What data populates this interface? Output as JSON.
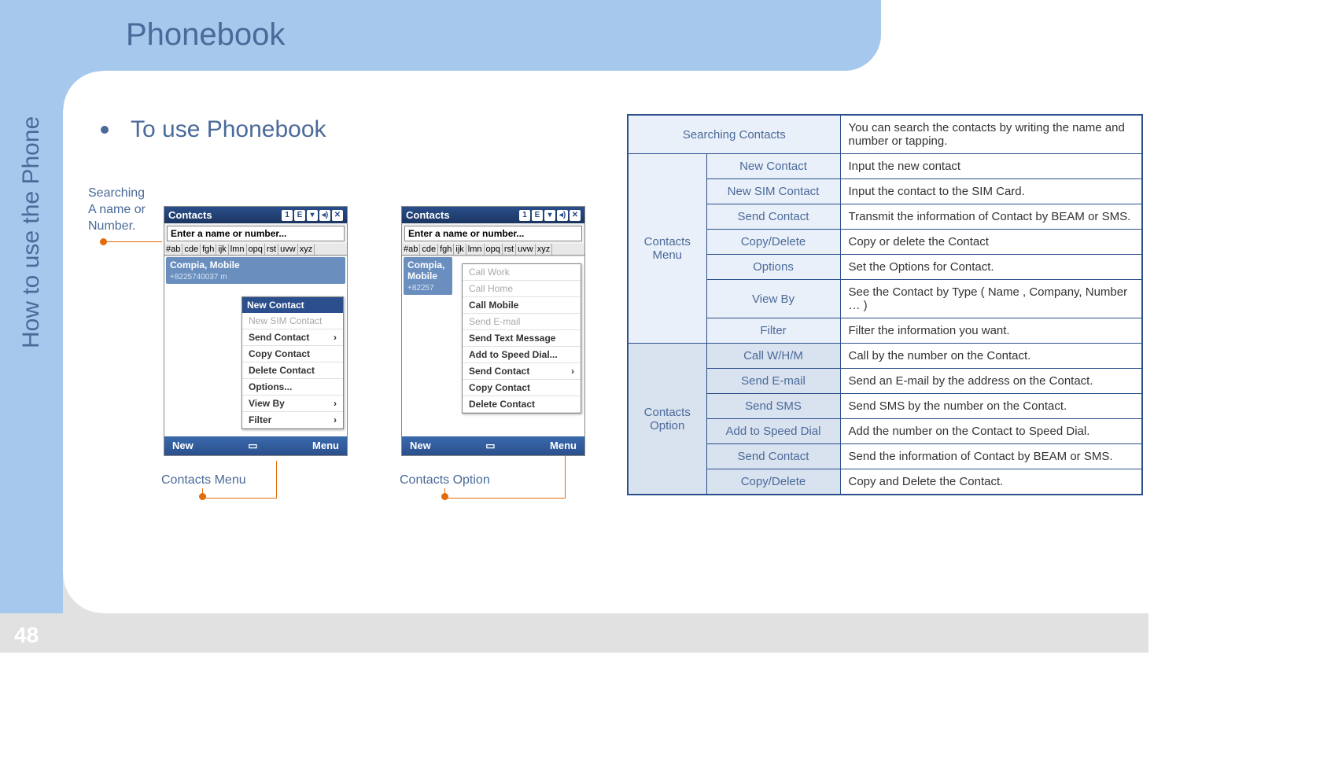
{
  "page": {
    "title": "Phonebook",
    "sidebar_text": "How to use the Phone",
    "page_number": "48",
    "section": "To use Phonebook"
  },
  "annotations": {
    "search_label": "Searching\nA name or\nNumber.",
    "contacts_menu_label": "Contacts Menu",
    "contacts_option_label": "Contacts Option"
  },
  "phone": {
    "title": "Contacts",
    "search_placeholder": "Enter a name or number...",
    "tabs": [
      "#ab",
      "cde",
      "fgh",
      "ijk",
      "lmn",
      "opq",
      "rst",
      "uvw",
      "xyz"
    ],
    "contact_name": "Compia, Mobile",
    "contact_num": "+8225740037 m",
    "contact_num2": "+82257",
    "soft_left": "New",
    "soft_right": "Menu",
    "menu1": {
      "header": "New Contact",
      "items": [
        {
          "t": "New SIM Contact",
          "dis": true
        },
        {
          "t": "Send Contact",
          "sub": true
        },
        {
          "t": "Copy Contact"
        },
        {
          "t": "Delete Contact"
        },
        {
          "t": "Options..."
        },
        {
          "t": "View By",
          "sub": true
        },
        {
          "t": "Filter",
          "sub": true
        }
      ]
    },
    "menu2": {
      "items": [
        {
          "t": "Call Work",
          "dis": true
        },
        {
          "t": "Call Home",
          "dis": true
        },
        {
          "t": "Call Mobile"
        },
        {
          "t": "Send E-mail",
          "dis": true
        },
        {
          "t": "Send Text Message"
        },
        {
          "t": "Add to Speed Dial..."
        },
        {
          "t": "Send Contact",
          "sub": true
        },
        {
          "t": "Copy Contact"
        },
        {
          "t": "Delete Contact"
        }
      ]
    }
  },
  "table": {
    "row_search": {
      "k": "Searching Contacts",
      "v": "You can search the contacts by writing  the name and number or tapping."
    },
    "group_menu_label": "Contacts Menu",
    "group_menu": [
      {
        "k": "New Contact",
        "v": "Input the new contact"
      },
      {
        "k": "New SIM Contact",
        "v": "Input the contact to the SIM Card."
      },
      {
        "k": "Send Contact",
        "v": "Transmit the information of Contact by BEAM or SMS."
      },
      {
        "k": "Copy/Delete",
        "v": "Copy or delete the Contact"
      },
      {
        "k": "Options",
        "v": "Set the Options for Contact."
      },
      {
        "k": "View By",
        "v": "See the Contact by Type ( Name , Company, Number … )"
      },
      {
        "k": "Filter",
        "v": "Filter the information you want."
      }
    ],
    "group_option_label": "Contacts Option",
    "group_option": [
      {
        "k": "Call W/H/M",
        "v": "Call by the number on the Contact."
      },
      {
        "k": "Send E-mail",
        "v": "Send an E-mail by the address on the Contact."
      },
      {
        "k": "Send SMS",
        "v": "Send SMS  by the number  on the Contact."
      },
      {
        "k": "Add to Speed Dial",
        "v": "Add the number on the Contact to Speed Dial."
      },
      {
        "k": "Send Contact",
        "v": "Send the information of Contact by BEAM or SMS."
      },
      {
        "k": "Copy/Delete",
        "v": "Copy and Delete the Contact."
      }
    ]
  }
}
